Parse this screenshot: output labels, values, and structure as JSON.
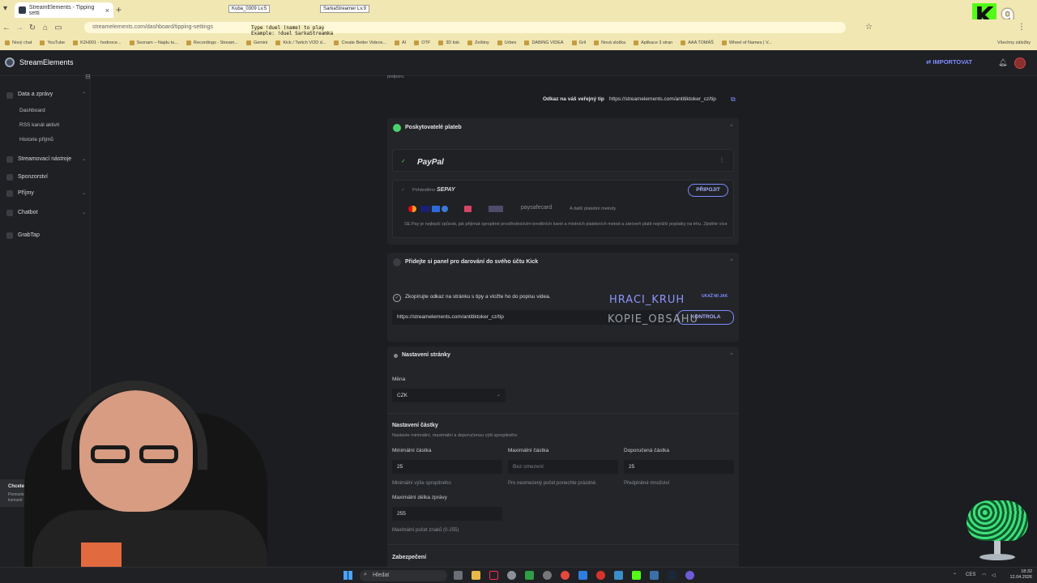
{
  "browser": {
    "tab_title": "StreamElements - Tipping setti",
    "url": "streamelements.com/dashboard/tipping-settings",
    "bookmarks": [
      "Nový chat",
      "YouTube",
      "K2H001 - hodnoce...",
      "Seznam – Najdu tu...",
      "Recordings - Stream...",
      "Gemini",
      "Kick / Twitch VOD d...",
      "Create Better Videos...",
      "AI",
      "OTF",
      "3D tisk",
      "Zeštiny",
      "Urbex",
      "DABING VIDEA",
      "Gril",
      "Nová složka",
      "Aplikace 3 stran",
      "AAA TOMÁŠ",
      "Wheel of Names | V..."
    ],
    "bookmarks_all": "Všechny záložky"
  },
  "overlay": {
    "chip1": "Kuba_0309 Lv.5",
    "chip2": "SarkaStreamer Lv.9",
    "cmd_line1": "Type !duel (name) to play",
    "cmd_line2": "Example: !duel SarkaStreamka",
    "kick_number": "9"
  },
  "app": {
    "brand": "StreamElements",
    "import_label": "IMPORTOVAT"
  },
  "sidebar": {
    "groups": [
      {
        "label": "Data a zprávy",
        "sub": [
          "Dashboard",
          "RSS kanál aktivit",
          "Historie příjmů"
        ]
      },
      {
        "label": "Streamovací nástroje"
      },
      {
        "label": "Sponzorství"
      },
      {
        "label": "Příjmy"
      },
      {
        "label": "Chatbot"
      },
      {
        "label": "GrabTap"
      }
    ]
  },
  "main": {
    "top_fragment": "podporu.",
    "public_tip_label": "Odkaz na váš veřejný tip",
    "public_tip_url": "https://streamelements.com/antitiktoker_cz/tip",
    "payments": {
      "title": "Poskytovatelé plateb",
      "paypal": "PayPal",
      "sepay_prefix": "Pohánděno",
      "sepay_brand": "SEPAY",
      "connect_label": "PŘIPOJIT",
      "paysafecard": "paysafecard",
      "more_methods": "A další platební metody",
      "description": "SE.Pay je nejlepší způsob, jak přijímat spropitné prostřednictvím kreditních karet a místních platebních metod a zároveň platit nejnižší poplatky na trhu.",
      "learn_more": "Zjistěte více"
    },
    "kick_panel": {
      "title": "Přidejte si panel pro darování do svého účtu Kick",
      "instruction": "Zkopírujte odkaz na stránku s tipy a vložte ho do popisu videa.",
      "show_me": "UKAŽ MI JAK",
      "url": "https://streamelements.com/antitiktoker_cz/tip",
      "check_label": "KONTROLA",
      "watermark1": "HRACI_KRUH",
      "watermark2": "KOPIE_OBSAHU"
    },
    "page_settings": {
      "title": "Nastavení stránky",
      "currency_label": "Měna",
      "currency_value": "CZK",
      "amount_title": "Nastavení částky",
      "amount_desc": "Nastavte minimální, maximální a doporučenou výši spropitného",
      "min_label": "Minimální částka",
      "min_value": "25",
      "min_hint": "Minimální výše spropitného",
      "max_label": "Maximální částka",
      "max_placeholder": "Bez omezení",
      "max_hint": "Pro neomezený počet ponechte prázdné.",
      "rec_label": "Doporučená částka",
      "rec_value": "25",
      "rec_hint": "Předplněné množství",
      "msg_label": "Maximální délka zprávy",
      "msg_value": "255",
      "msg_hint": "Maximální počet znaků (0-255)",
      "security_title": "Zabezpečení"
    }
  },
  "side_popup": {
    "title": "Chcete něco vrátit...",
    "body": "Pomozte nám posílit více komunit"
  },
  "taskbar": {
    "search": "Hledat",
    "lang": "CES",
    "time": "18:32",
    "date": "12.04.2026"
  }
}
